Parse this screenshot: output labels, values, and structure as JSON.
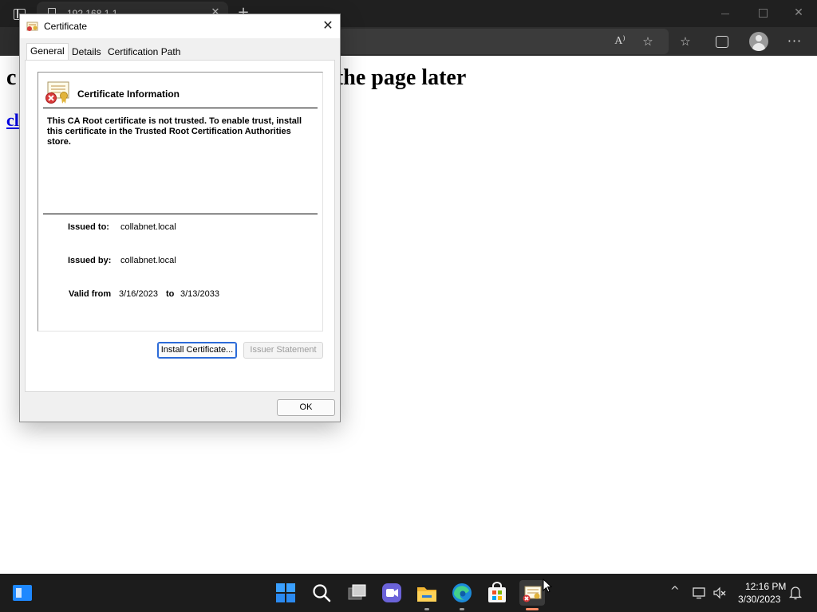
{
  "browser": {
    "tab_title": "192.168.1.1",
    "tab_close_glyph": "✕",
    "new_tab_glyph": "+",
    "close_glyph": "✕",
    "read_aloud_glyph": "A⁾",
    "add_favorite_glyph": "☆",
    "favorites_glyph": "☆",
    "more_glyph": "···"
  },
  "page": {
    "heading": "c                                                 st of the page later",
    "link_text": "cl"
  },
  "dialog": {
    "title": "Certificate",
    "close_glyph": "✕",
    "tabs": [
      {
        "label": "General",
        "active": true
      },
      {
        "label": "Details",
        "active": false
      },
      {
        "label": "Certification Path",
        "active": false
      }
    ],
    "info": {
      "heading": "Certificate Information",
      "message": "This CA Root certificate is not trusted. To enable trust, install this certificate in the Trusted Root Certification Authorities store.",
      "issued_to_label": "Issued to:",
      "issued_to_value": "collabnet.local",
      "issued_by_label": "Issued by:",
      "issued_by_value": "collabnet.local",
      "valid_from_label": "Valid from",
      "valid_from_value": "3/16/2023",
      "valid_to_label": "to",
      "valid_to_value": "3/13/2033"
    },
    "buttons": {
      "install": "Install Certificate...",
      "issuer_statement": "Issuer Statement",
      "ok": "OK"
    }
  },
  "taskbar": {
    "time": "12:16 PM",
    "date": "3/30/2023",
    "tray_chevron_glyph": "^"
  },
  "colors": {
    "accent": "#2c6bd8",
    "link": "#0000ee",
    "titlebar_dark": "#202020",
    "taskbar": "#1c1c1c"
  }
}
